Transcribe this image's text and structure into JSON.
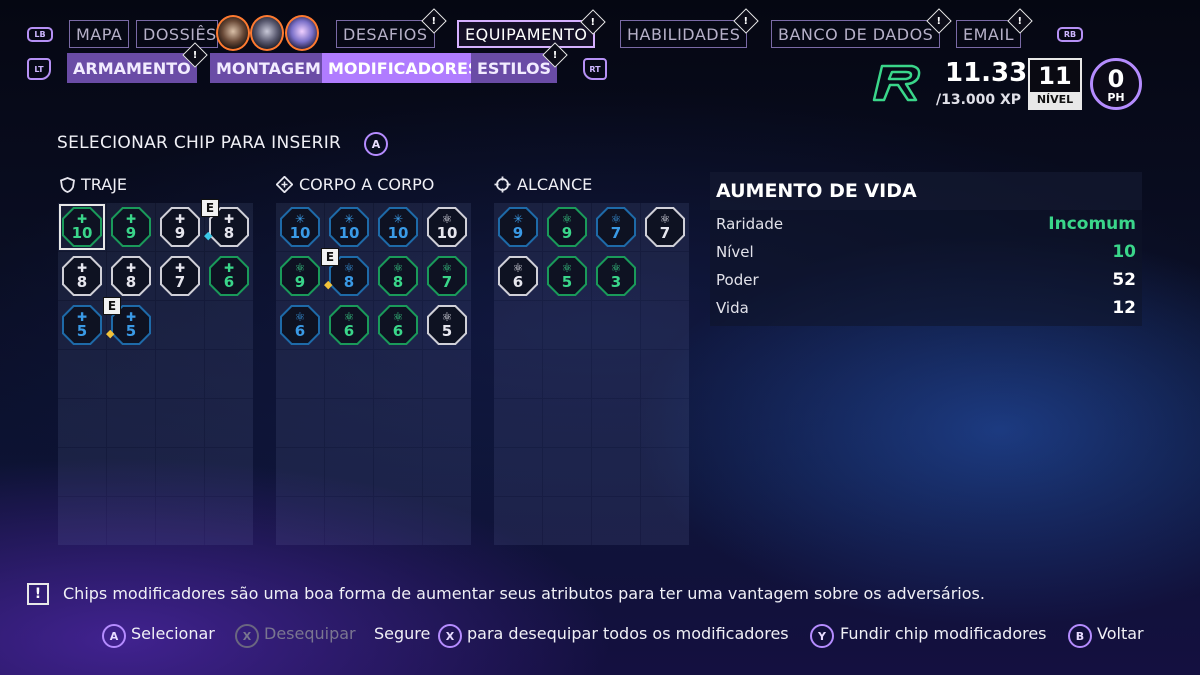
{
  "top_nav": {
    "left_bumper": "LB",
    "right_bumper": "RB",
    "tabs": [
      {
        "label": "MAPA",
        "badge": ""
      },
      {
        "label": "DOSSIÊS",
        "badge": ""
      },
      {
        "label": "DESAFIOS",
        "badge": "!"
      },
      {
        "label": "EQUIPAMENTO",
        "badge": "!"
      },
      {
        "label": "HABILIDADES",
        "badge": "!"
      },
      {
        "label": "BANCO DE DADOS",
        "badge": "!"
      },
      {
        "label": "EMAIL",
        "badge": "!"
      }
    ],
    "active_tab": "EQUIPAMENTO"
  },
  "sub_nav": {
    "left_trigger": "LT",
    "right_trigger": "RT",
    "tabs": [
      {
        "label": "ARMAMENTO",
        "badge": "!"
      },
      {
        "label": "MONTAGEM",
        "badge": ""
      },
      {
        "label": "MODIFICADORES",
        "badge": ""
      },
      {
        "label": "ESTILOS",
        "badge": "!"
      }
    ],
    "active_tab": "MODIFICADORES"
  },
  "player": {
    "character_logo": "R",
    "xp": "11.335",
    "xp_total": "/13.000 XP",
    "level": "11",
    "level_label": "NÍVEL",
    "points": "0",
    "points_label": "PH"
  },
  "instruction": {
    "text": "SELECIONAR CHIP PARA INSERIR",
    "button": "A"
  },
  "sections": [
    {
      "title": "TRAJE",
      "icon": "shield-icon",
      "chips": [
        {
          "value": "10",
          "color": "green",
          "icon": "plus-icon",
          "selected": true
        },
        {
          "value": "9",
          "color": "green",
          "icon": "plus-icon"
        },
        {
          "value": "9",
          "color": "white",
          "icon": "plus-icon"
        },
        {
          "value": "8",
          "color": "white",
          "icon": "plus-icon",
          "equipped": "E",
          "equipped_symbol": "◆"
        },
        {
          "value": "8",
          "color": "white",
          "icon": "plus-icon"
        },
        {
          "value": "8",
          "color": "white",
          "icon": "plus-icon"
        },
        {
          "value": "7",
          "color": "white",
          "icon": "plus-icon"
        },
        {
          "value": "6",
          "color": "green",
          "icon": "plus-icon"
        },
        {
          "value": "5",
          "color": "blue",
          "icon": "plus-icon"
        },
        {
          "value": "5",
          "color": "blue",
          "icon": "plus-icon",
          "equipped": "E",
          "equipped_symbol": "◆"
        }
      ]
    },
    {
      "title": "CORPO A CORPO",
      "icon": "melee-icon",
      "chips": [
        {
          "value": "10",
          "color": "blue",
          "icon": "burst-icon"
        },
        {
          "value": "10",
          "color": "blue",
          "icon": "burst-icon"
        },
        {
          "value": "10",
          "color": "blue",
          "icon": "burst-icon"
        },
        {
          "value": "10",
          "color": "white",
          "icon": "atom-icon"
        },
        {
          "value": "9",
          "color": "green",
          "icon": "atom-icon"
        },
        {
          "value": "8",
          "color": "blue",
          "icon": "atom-icon",
          "equipped": "E",
          "equipped_symbol": "◆"
        },
        {
          "value": "8",
          "color": "green",
          "icon": "atom-icon"
        },
        {
          "value": "7",
          "color": "green",
          "icon": "atom-icon"
        },
        {
          "value": "6",
          "color": "blue",
          "icon": "atom-icon"
        },
        {
          "value": "6",
          "color": "green",
          "icon": "atom-icon"
        },
        {
          "value": "6",
          "color": "green",
          "icon": "atom-icon"
        },
        {
          "value": "5",
          "color": "white",
          "icon": "atom-icon"
        }
      ]
    },
    {
      "title": "ALCANCE",
      "icon": "crosshair-icon",
      "chips": [
        {
          "value": "9",
          "color": "blue",
          "icon": "burst-icon"
        },
        {
          "value": "9",
          "color": "green",
          "icon": "atom-icon"
        },
        {
          "value": "7",
          "color": "blue",
          "icon": "atom-icon"
        },
        {
          "value": "7",
          "color": "white",
          "icon": "atom-icon"
        },
        {
          "value": "6",
          "color": "white",
          "icon": "atom-icon"
        },
        {
          "value": "5",
          "color": "green",
          "icon": "atom-icon"
        },
        {
          "value": "3",
          "color": "green",
          "icon": "atom-icon"
        }
      ]
    }
  ],
  "detail": {
    "title": "AUMENTO DE VIDA",
    "rows": [
      {
        "label": "Raridade",
        "value": "Incomum",
        "accent": "green"
      },
      {
        "label": "Nível",
        "value": "10",
        "accent": "green"
      },
      {
        "label": "Poder",
        "value": "52",
        "accent": "white"
      },
      {
        "label": "Vida",
        "value": "12",
        "accent": "white"
      }
    ]
  },
  "tip": {
    "icon": "!",
    "text": "Chips modificadores são uma boa forma de aumentar seus atributos para ter uma vantagem sobre os adversários."
  },
  "prompts": {
    "select": {
      "button": "A",
      "label": "Selecionar"
    },
    "unequip": {
      "button": "X",
      "label": "Desequipar"
    },
    "hold": {
      "prefix": "Segure",
      "button": "X",
      "label": "para desequipar todos os modificadores"
    },
    "merge": {
      "button": "Y",
      "label": "Fundir chip modificadores"
    },
    "back": {
      "button": "B",
      "label": "Voltar"
    }
  },
  "colors": {
    "accent_purple": "#b07cff",
    "chip_green": "#3ad68a",
    "chip_blue": "#3a9ae6",
    "chip_white": "#e6e6ee",
    "rarity_green": "#3ad68a"
  }
}
